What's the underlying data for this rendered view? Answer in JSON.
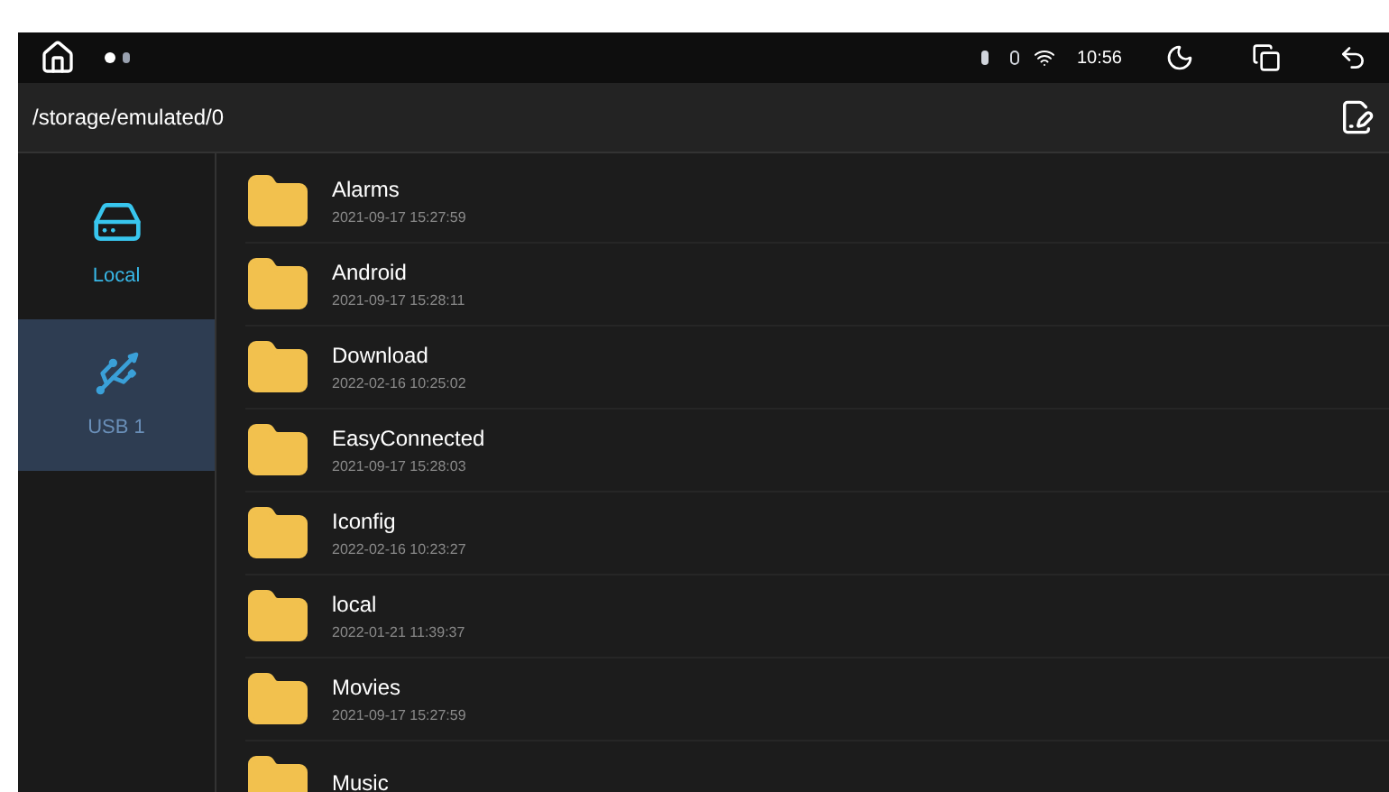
{
  "status_bar": {
    "time": "10:56"
  },
  "path_bar": {
    "path": "/storage/emulated/0"
  },
  "sidebar": {
    "items": [
      {
        "kind": "local",
        "label": "Local",
        "selected": true,
        "highlighted": false
      },
      {
        "kind": "usb",
        "label": "USB 1",
        "selected": false,
        "highlighted": true
      }
    ]
  },
  "files": [
    {
      "name": "Alarms",
      "date": "2021-09-17 15:27:59"
    },
    {
      "name": "Android",
      "date": "2021-09-17 15:28:11"
    },
    {
      "name": "Download",
      "date": "2022-02-16 10:25:02"
    },
    {
      "name": "EasyConnected",
      "date": "2021-09-17 15:28:03"
    },
    {
      "name": "Iconfig",
      "date": "2022-02-16 10:23:27"
    },
    {
      "name": "local",
      "date": "2022-01-21 11:39:37"
    },
    {
      "name": "Movies",
      "date": "2021-09-17 15:27:59"
    },
    {
      "name": "Music"
    }
  ]
}
